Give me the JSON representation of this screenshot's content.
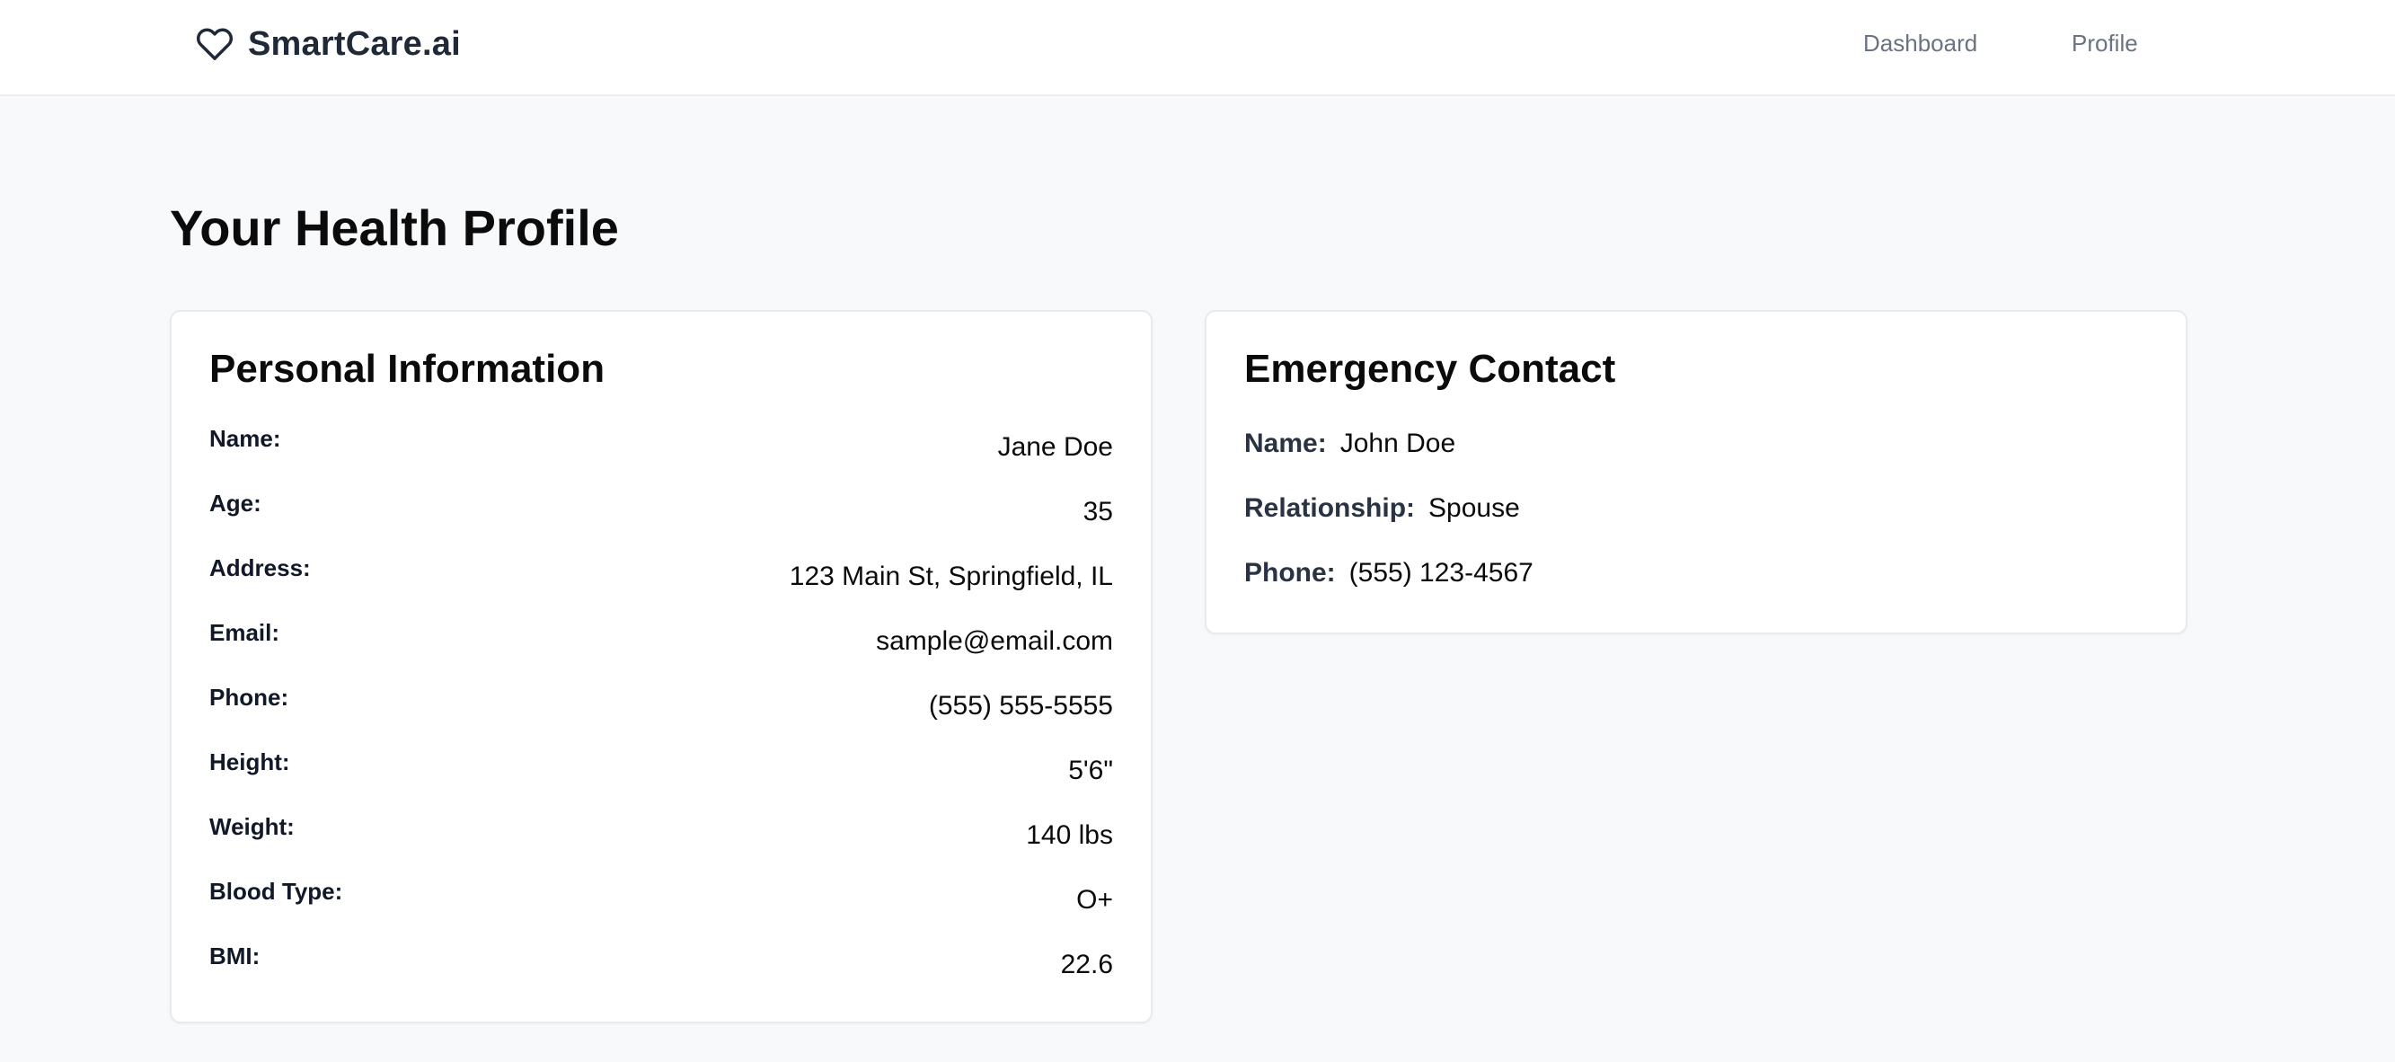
{
  "app": {
    "brand_name": "SmartCare.ai",
    "logo_icon": "heart-icon"
  },
  "nav": {
    "dashboard_label": "Dashboard",
    "profile_label": "Profile"
  },
  "page": {
    "title": "Your Health Profile"
  },
  "personal": {
    "title": "Personal Information",
    "fields": [
      {
        "label": "Name:",
        "value": "Jane Doe"
      },
      {
        "label": "Age:",
        "value": "35"
      },
      {
        "label": "Address:",
        "value": "123 Main St, Springfield, IL"
      },
      {
        "label": "Email:",
        "value": "sample@email.com"
      },
      {
        "label": "Phone:",
        "value": "(555) 555-5555"
      },
      {
        "label": "Height:",
        "value": "5'6\""
      },
      {
        "label": "Weight:",
        "value": "140 lbs"
      },
      {
        "label": "Blood Type:",
        "value": "O+"
      },
      {
        "label": "BMI:",
        "value": "22.6"
      }
    ]
  },
  "emergency": {
    "title": "Emergency Contact",
    "fields": [
      {
        "label": "Name:",
        "value": "John Doe"
      },
      {
        "label": "Relationship:",
        "value": "Spouse"
      },
      {
        "label": "Phone:",
        "value": "(555) 123-4567"
      }
    ]
  },
  "colors": {
    "background": "#f8f9fb",
    "card": "#ffffff",
    "nav_text": "#6b7280",
    "heading": "#0b0b0b"
  }
}
